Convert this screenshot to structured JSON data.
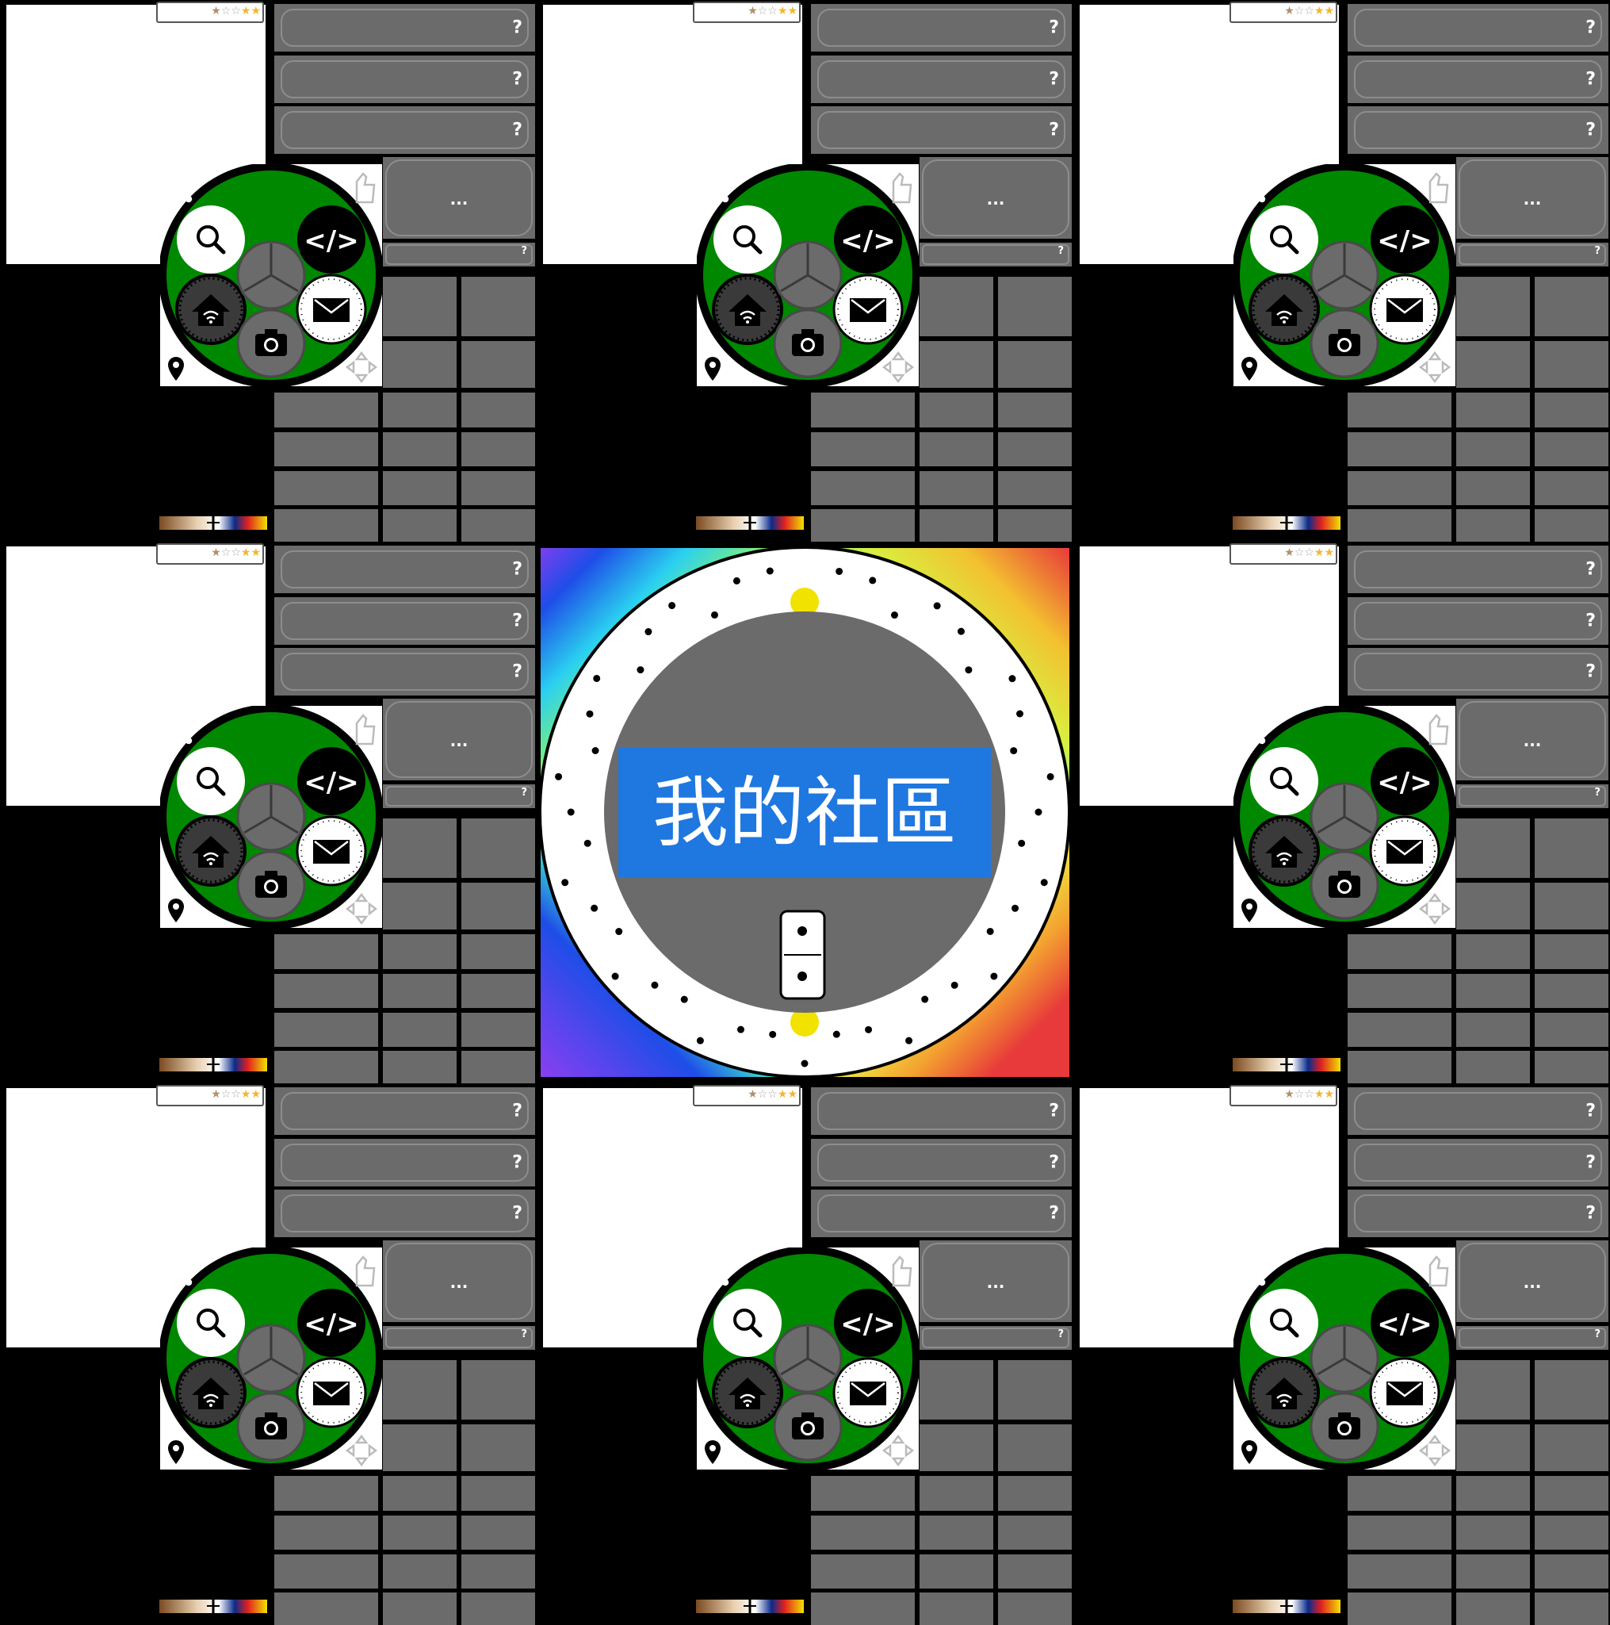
{
  "tile": {
    "rating": {
      "stars": 5,
      "filled": 1,
      "gold": 2
    },
    "help_buttons": [
      "?",
      "?",
      "?"
    ],
    "ellipsis_label": "...",
    "small_help_label": "?",
    "icons": {
      "search": "magnifier-icon",
      "code": "code-brackets-icon",
      "home": "home-wifi-icon",
      "mail": "envelope-icon",
      "camera": "camera-icon",
      "center": "tri-spoke-icon",
      "share": "share-icon",
      "thumb": "thumbs-up-icon",
      "location": "map-pin-icon",
      "move": "move-arrows-icon"
    },
    "colors": {
      "green": "#008800",
      "gray": "#6b6b6b",
      "white": "#ffffff",
      "black": "#000000"
    }
  },
  "center": {
    "title": "我的社區",
    "title_bg": "#1f77e0",
    "domino": {
      "top_pips": 1,
      "bottom_pips": 1
    }
  }
}
